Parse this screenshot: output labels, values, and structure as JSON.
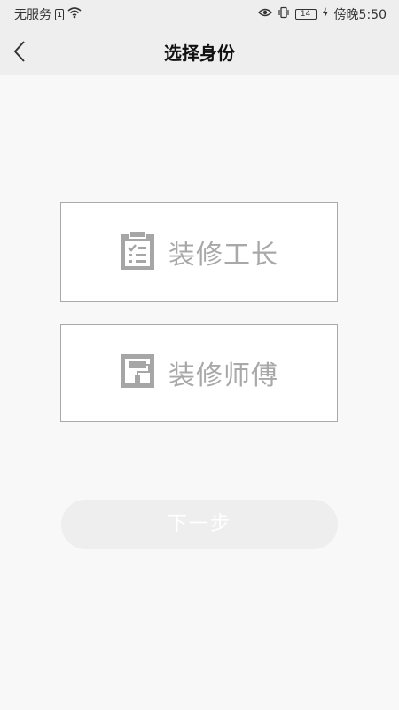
{
  "status_bar": {
    "carrier": "无服务",
    "battery_level": "14",
    "time": "傍晚5:50"
  },
  "header": {
    "title": "选择身份",
    "back_icon": "chevron-left-icon"
  },
  "roles": [
    {
      "label": "装修工长",
      "icon": "clipboard-checklist-icon"
    },
    {
      "label": "装修师傅",
      "icon": "paint-roller-icon"
    }
  ],
  "actions": {
    "next_label": "下一步"
  },
  "colors": {
    "page_bg": "#f8f8f8",
    "header_bg": "#eeeeee",
    "card_border": "#a9a9a9",
    "role_text": "#a8a8a8",
    "icon_gray": "#a6a6a6",
    "disabled_button_bg": "#eeeeee"
  }
}
